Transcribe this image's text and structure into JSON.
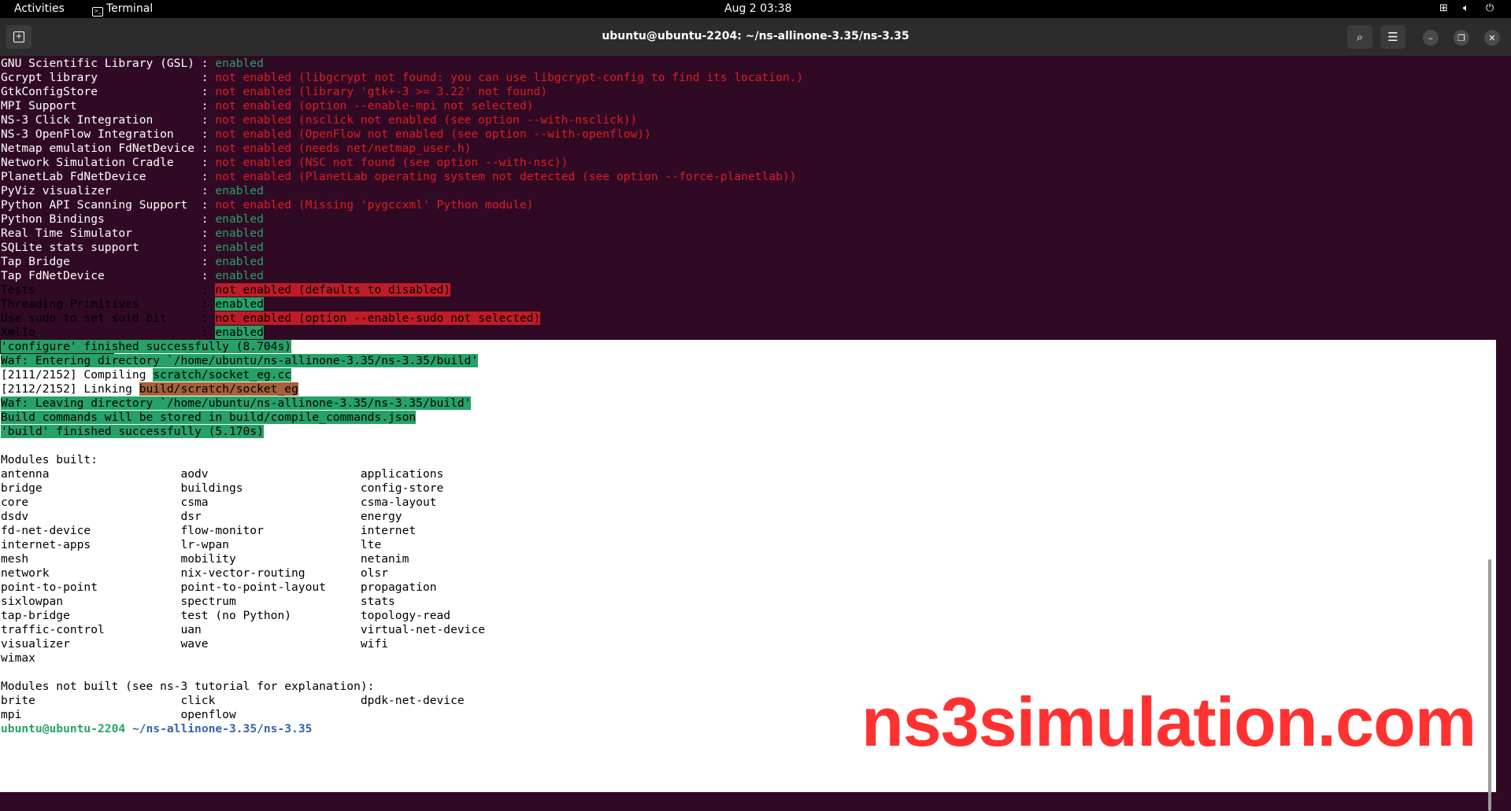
{
  "topbar": {
    "activities": "Activities",
    "app_name": "Terminal",
    "datetime": "Aug 2  03:38"
  },
  "window": {
    "title": "ubuntu@ubuntu-2204: ~/ns-allinone-3.35/ns-3.35"
  },
  "config_lines": [
    {
      "label": "GNU Scientific Library (GSL)",
      "value": "enabled",
      "status": "ok"
    },
    {
      "label": "Gcrypt library",
      "value": "not enabled (libgcrypt not found: you can use libgcrypt-config to find its location.)",
      "status": "err"
    },
    {
      "label": "GtkConfigStore",
      "value": "not enabled (library 'gtk+-3 >= 3.22' not found)",
      "status": "err"
    },
    {
      "label": "MPI Support",
      "value": "not enabled (option --enable-mpi not selected)",
      "status": "err"
    },
    {
      "label": "NS-3 Click Integration",
      "value": "not enabled (nsclick not enabled (see option --with-nsclick))",
      "status": "err"
    },
    {
      "label": "NS-3 OpenFlow Integration",
      "value": "not enabled (OpenFlow not enabled (see option --with-openflow))",
      "status": "err"
    },
    {
      "label": "Netmap emulation FdNetDevice",
      "value": "not enabled (needs net/netmap_user.h)",
      "status": "err"
    },
    {
      "label": "Network Simulation Cradle",
      "value": "not enabled (NSC not found (see option --with-nsc))",
      "status": "err"
    },
    {
      "label": "PlanetLab FdNetDevice",
      "value": "not enabled (PlanetLab operating system not detected (see option --force-planetlab))",
      "status": "err"
    },
    {
      "label": "PyViz visualizer",
      "value": "enabled",
      "status": "ok"
    },
    {
      "label": "Python API Scanning Support",
      "value": "not enabled (Missing 'pygccxml' Python module)",
      "status": "err"
    },
    {
      "label": "Python Bindings",
      "value": "enabled",
      "status": "ok"
    },
    {
      "label": "Real Time Simulator",
      "value": "enabled",
      "status": "ok"
    },
    {
      "label": "SQLite stats support",
      "value": "enabled",
      "status": "ok"
    },
    {
      "label": "Tap Bridge",
      "value": "enabled",
      "status": "ok"
    },
    {
      "label": "Tap FdNetDevice",
      "value": "enabled",
      "status": "ok"
    },
    {
      "label": "Tests",
      "value": "not enabled (defaults to disabled)",
      "status": "err-sel"
    },
    {
      "label": "Threading Primitives",
      "value": "enabled",
      "status": "ok-sel"
    },
    {
      "label": "Use sudo to set suid bit",
      "value": "not enabled (option --enable-sudo not selected)",
      "status": "err-sel"
    },
    {
      "label": "XmlIo",
      "value": "enabled",
      "status": "ok-sel"
    }
  ],
  "build_output": {
    "configure_done": "'configure' finished successfully (8.704s)",
    "waf_enter": "Waf: Entering directory `/home/ubuntu/ns-allinone-3.35/ns-3.35/build'",
    "compiling_prefix": "[2111/2152] Compiling ",
    "compiling_file": "scratch/socket_eg.cc",
    "linking_prefix": "[2112/2152] Linking ",
    "linking_file": "build/scratch/socket_eg",
    "waf_leave": "Waf: Leaving directory `/home/ubuntu/ns-allinone-3.35/ns-3.35/build'",
    "build_commands": "Build commands will be stored in build/compile_commands.json",
    "build_done": "'build' finished successfully (5.170s)"
  },
  "modules_built_heading": "Modules built:",
  "modules_built": [
    [
      "antenna",
      "aodv",
      "applications"
    ],
    [
      "bridge",
      "buildings",
      "config-store"
    ],
    [
      "core",
      "csma",
      "csma-layout"
    ],
    [
      "dsdv",
      "dsr",
      "energy"
    ],
    [
      "fd-net-device",
      "flow-monitor",
      "internet"
    ],
    [
      "internet-apps",
      "lr-wpan",
      "lte"
    ],
    [
      "mesh",
      "mobility",
      "netanim"
    ],
    [
      "network",
      "nix-vector-routing",
      "olsr"
    ],
    [
      "point-to-point",
      "point-to-point-layout",
      "propagation"
    ],
    [
      "sixlowpan",
      "spectrum",
      "stats"
    ],
    [
      "tap-bridge",
      "test (no Python)",
      "topology-read"
    ],
    [
      "traffic-control",
      "uan",
      "virtual-net-device"
    ],
    [
      "visualizer",
      "wave",
      "wifi"
    ],
    [
      "wimax",
      "",
      ""
    ]
  ],
  "modules_not_built_heading": "Modules not built (see ns-3 tutorial for explanation):",
  "modules_not_built": [
    [
      "brite",
      "click",
      "dpdk-net-device"
    ],
    [
      "mpi",
      "openflow",
      ""
    ]
  ],
  "prompt": {
    "user_host": "ubuntu@ubuntu-2204",
    "sep": ":",
    "path": "~/ns-allinone-3.35/ns-3.35",
    "symbol": "$"
  },
  "watermark": "ns3simulation.com"
}
